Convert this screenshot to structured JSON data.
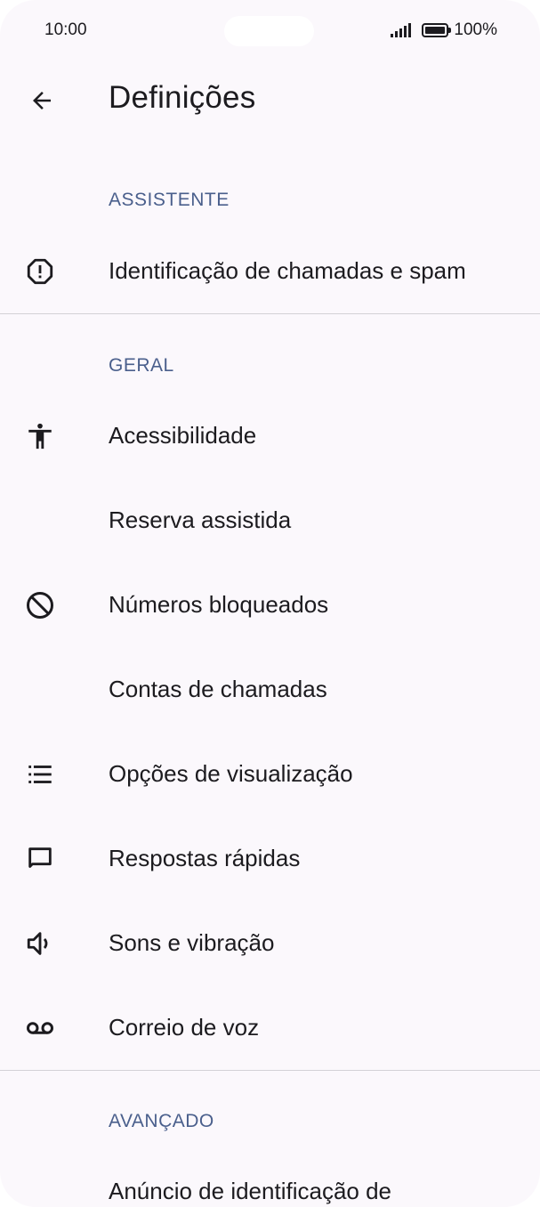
{
  "status_bar": {
    "time": "10:00",
    "battery": "100%"
  },
  "app_bar": {
    "title": "Definições",
    "back_icon": "arrow-back-icon"
  },
  "sections": {
    "assistant": {
      "header": "ASSISTENTE",
      "items": [
        {
          "label": "Identificação de chamadas e spam",
          "icon": "alert-octagon-icon"
        }
      ]
    },
    "general": {
      "header": "GERAL",
      "items": [
        {
          "label": "Acessibilidade",
          "icon": "accessibility-icon"
        },
        {
          "label": "Reserva assistida",
          "icon": ""
        },
        {
          "label": "Números bloqueados",
          "icon": "block-icon"
        },
        {
          "label": "Contas de chamadas",
          "icon": ""
        },
        {
          "label": "Opções de visualização",
          "icon": "list-icon"
        },
        {
          "label": "Respostas rápidas",
          "icon": "message-icon"
        },
        {
          "label": "Sons e vibração",
          "icon": "volume-icon"
        },
        {
          "label": "Correio de voz",
          "icon": "voicemail-icon"
        }
      ]
    },
    "advanced": {
      "header": "AVANÇADO",
      "items": [
        {
          "label": "Anúncio de identificação de",
          "icon": ""
        }
      ]
    }
  }
}
